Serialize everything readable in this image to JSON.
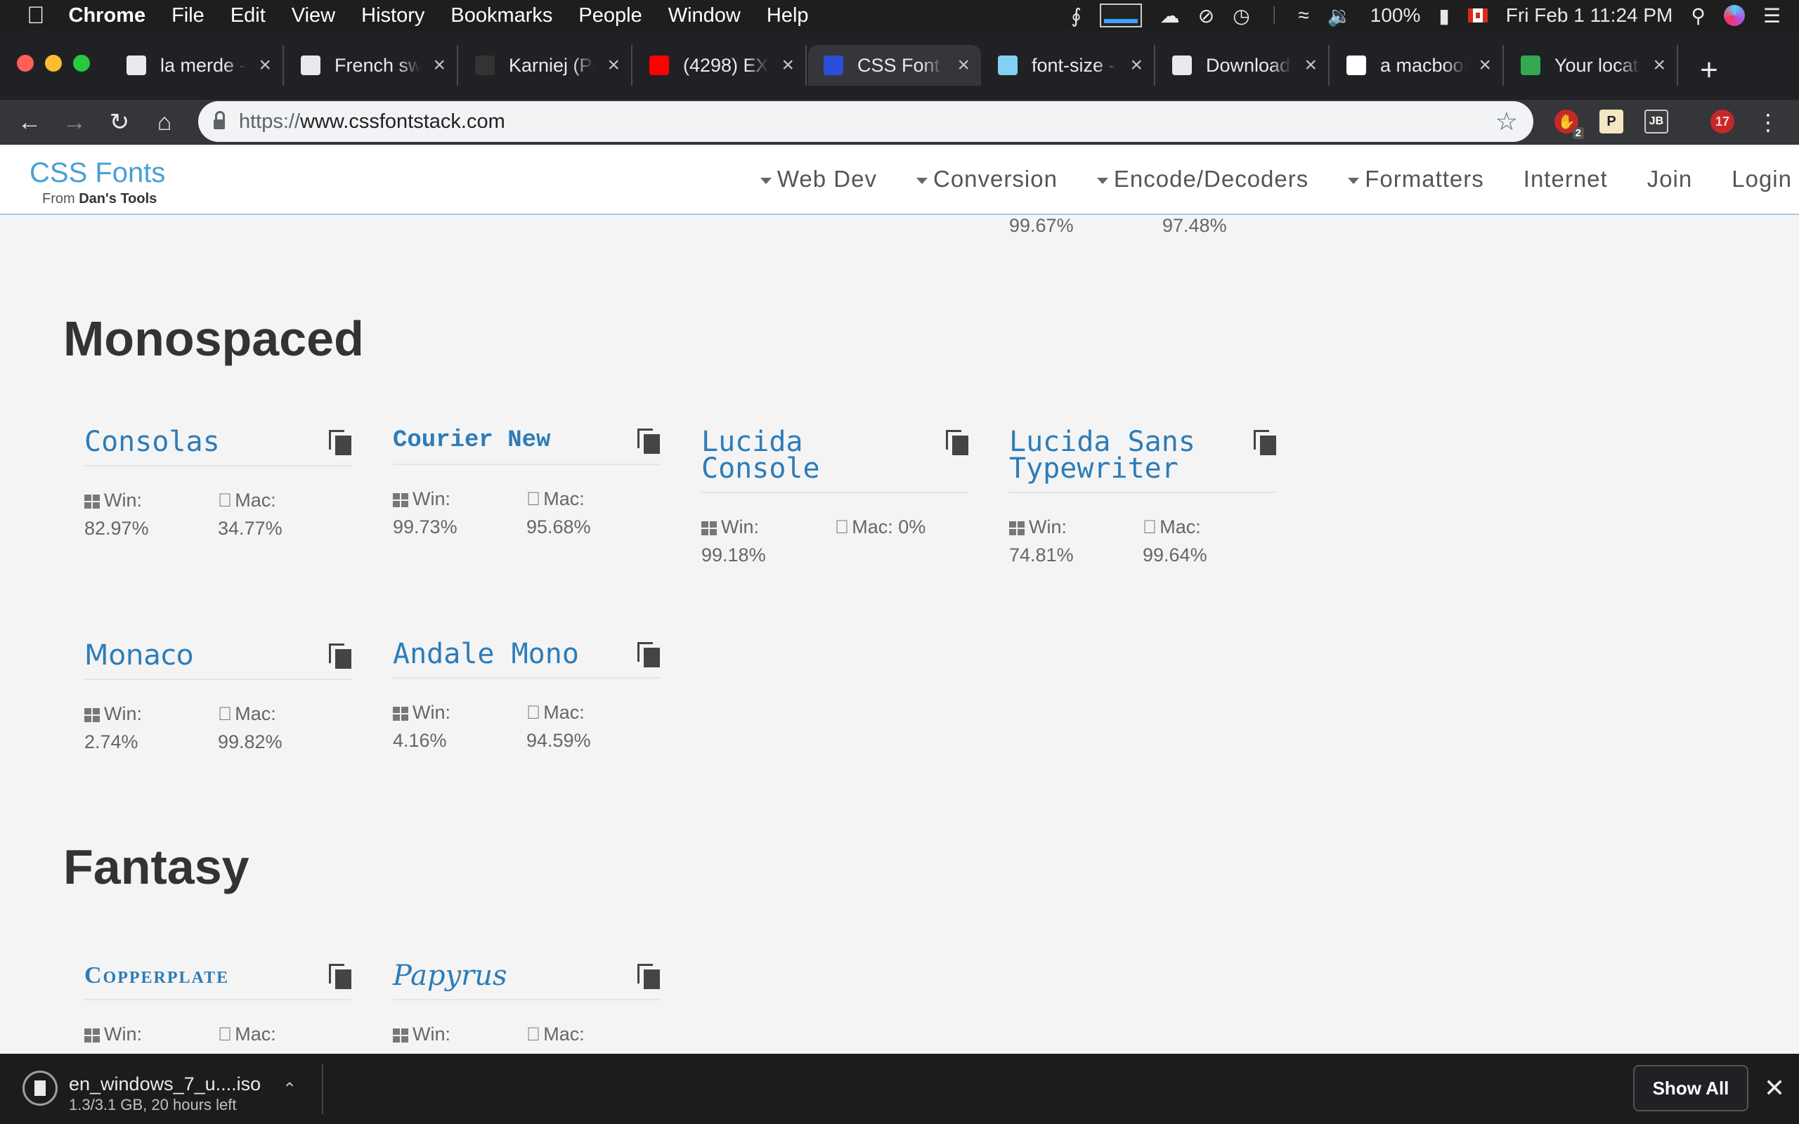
{
  "menubar": {
    "app_name": "Chrome",
    "items": [
      "File",
      "Edit",
      "View",
      "History",
      "Bookmarks",
      "People",
      "Window",
      "Help"
    ],
    "battery": "100%",
    "clock": "Fri Feb 1  11:24 PM"
  },
  "tabs": [
    {
      "title": "la merde -",
      "favicon": "g-icon",
      "favicon_color": "#e8eaed"
    },
    {
      "title": "French sw",
      "favicon": "document-icon",
      "favicon_color": "#e8eaed"
    },
    {
      "title": "Karniej (Pa",
      "favicon": "github-icon",
      "favicon_color": "#333333"
    },
    {
      "title": "(4298) EX",
      "favicon": "youtube-icon",
      "favicon_color": "#ff0000"
    },
    {
      "title": "CSS Font S",
      "favicon": "dans-tools-icon",
      "favicon_color": "#2b4fd8",
      "active": true
    },
    {
      "title": "font-size -",
      "favicon": "mdn-icon",
      "favicon_color": "#83d0f2"
    },
    {
      "title": "Downloads",
      "favicon": "download-icon",
      "favicon_color": "#e8eaed"
    },
    {
      "title": "a macbook",
      "favicon": "google-icon",
      "favicon_color": "#ffffff"
    },
    {
      "title": "Your locati",
      "favicon": "maps-icon",
      "favicon_color": "#34a853"
    }
  ],
  "toolbar": {
    "url_scheme": "https://",
    "url_host": "www.cssfontstack.com",
    "extensions": [
      {
        "name": "adblock-icon",
        "badge": "2",
        "color": "#c62828"
      },
      {
        "name": "p-extension-icon",
        "label": "P",
        "color": "#f3e7c4"
      },
      {
        "name": "jb-extension-icon",
        "label": "JB",
        "color": "#3c3c3c"
      },
      {
        "name": "count-extension-icon",
        "label": "17",
        "color": "#c62828"
      }
    ]
  },
  "site": {
    "brand": "CSS Fonts",
    "brand_from": "From ",
    "brand_tools": "Dan's Tools",
    "nav": [
      {
        "label": "Web Dev",
        "dropdown": true
      },
      {
        "label": "Conversion",
        "dropdown": true
      },
      {
        "label": "Encode/Decoders",
        "dropdown": true
      },
      {
        "label": "Formatters",
        "dropdown": true
      },
      {
        "label": "Internet",
        "dropdown": false
      },
      {
        "label": "Join",
        "dropdown": false
      },
      {
        "label": "Login",
        "dropdown": false
      }
    ]
  },
  "content": {
    "prev_stats": {
      "win": "99.67%",
      "mac": "97.48%"
    },
    "sections": [
      {
        "title": "Monospaced",
        "fonts": [
          {
            "name": "Consolas",
            "win_label": "Win:",
            "win": "82.97%",
            "mac_label": "Mac:",
            "mac": "34.77%"
          },
          {
            "name": "Courier New",
            "win_label": "Win:",
            "win": "99.73%",
            "mac_label": "Mac:",
            "mac": "95.68%"
          },
          {
            "name": "Lucida Console",
            "win_label": "Win:",
            "win": "99.18%",
            "mac_label": "Mac: 0%",
            "mac": ""
          },
          {
            "name": "Lucida Sans Typewriter",
            "win_label": "Win:",
            "win": "74.81%",
            "mac_label": "Mac:",
            "mac": "99.64%"
          },
          {
            "name": "Monaco",
            "win_label": "Win:",
            "win": "2.74%",
            "mac_label": "Mac:",
            "mac": "99.82%"
          },
          {
            "name": "Andale Mono",
            "win_label": "Win:",
            "win": "4.16%",
            "mac_label": "Mac:",
            "mac": "94.59%"
          }
        ]
      },
      {
        "title": "Fantasy",
        "fonts": [
          {
            "name": "Copperplate",
            "win_label": "Win:",
            "mac_label": "Mac:"
          },
          {
            "name": "Papyrus",
            "win_label": "Win:",
            "mac_label": "Mac:"
          }
        ]
      }
    ]
  },
  "download": {
    "filename": "en_windows_7_u....iso",
    "status": "1.3/3.1 GB, 20 hours left",
    "show_all": "Show All"
  }
}
